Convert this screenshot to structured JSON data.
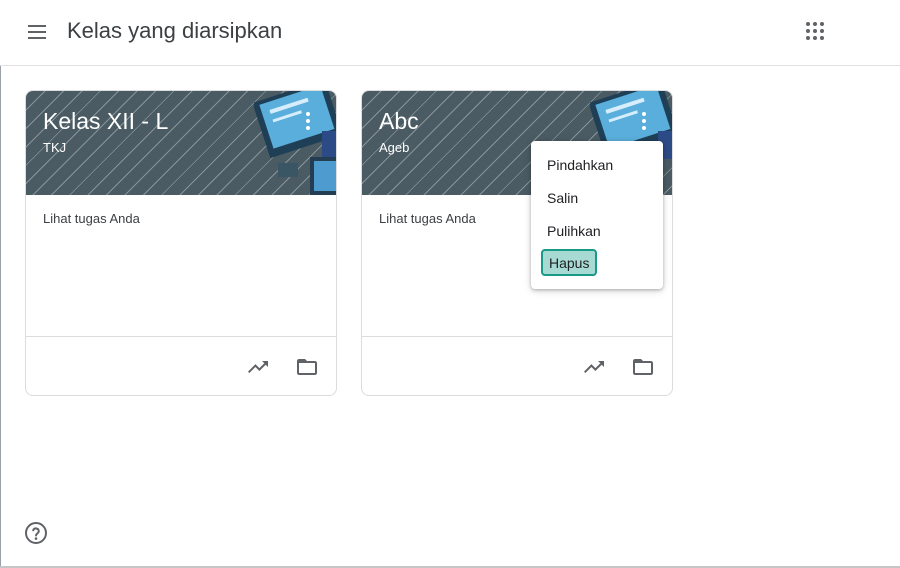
{
  "header": {
    "title": "Kelas yang diarsipkan",
    "menu_icon": "hamburger-menu-icon",
    "apps_icon": "google-apps-icon"
  },
  "courses": [
    {
      "name": "Kelas XII - L",
      "section": "TKJ",
      "work_link": "Lihat tugas Anda"
    },
    {
      "name": "Abc",
      "section": "Ageb",
      "work_link": "Lihat tugas Anda"
    }
  ],
  "card_menu": {
    "items": [
      "Pindahkan",
      "Salin",
      "Pulihkan",
      "Hapus"
    ],
    "highlighted": "Hapus"
  },
  "colors": {
    "banner": "#4a5b63",
    "highlight_fill": "#a8dad4",
    "highlight_border": "#199a86"
  },
  "icons": {
    "footer_left": "trending-up-icon",
    "footer_right": "folder-icon",
    "help": "help-icon"
  }
}
